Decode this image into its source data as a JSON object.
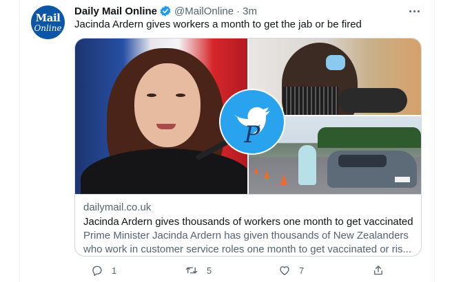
{
  "tweet": {
    "avatar": {
      "line1": "Mail",
      "line2": "Online"
    },
    "display_name": "Daily Mail Online",
    "verified_icon": "verified-badge-icon",
    "handle": "@MailOnline",
    "separator": "·",
    "time": "3m",
    "text": "Jacinda Ardern gives workers a month to get the jab or be fired"
  },
  "card": {
    "watermark_letter": "P",
    "domain": "dailymail.co.uk",
    "title": "Jacinda Ardern gives thousands of workers one month to get vaccinated",
    "description_line1": "Prime Minister Jacinda Ardern has given thousands of New Zealanders",
    "description_line2": "who work in customer service roles one month to get vaccinated or ris..."
  },
  "actions": {
    "reply": {
      "icon": "reply-icon",
      "count": "1"
    },
    "retweet": {
      "icon": "retweet-icon",
      "count": "5"
    },
    "like": {
      "icon": "heart-icon",
      "count": "7"
    },
    "share": {
      "icon": "share-icon"
    }
  },
  "colors": {
    "verified": "#1d9bf0",
    "secondary_text": "#536471",
    "avatar_bg": "#0b56a7",
    "watermark_bg": "#2aa3ef"
  }
}
